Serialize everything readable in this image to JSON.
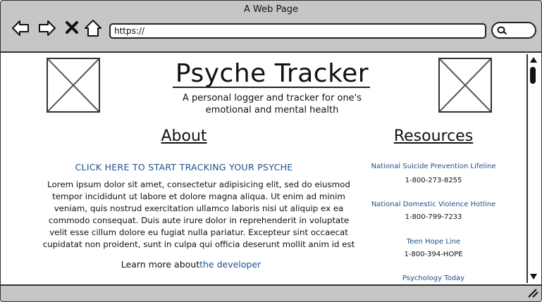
{
  "window": {
    "title": "A Web Page"
  },
  "toolbar": {
    "url": "https://"
  },
  "page": {
    "title": "Psyche Tracker",
    "tagline": "A personal logger and tracker for one's emotional and mental health",
    "about": {
      "heading": "About",
      "cta": "CLICK HERE TO START TRACKING YOUR PSYCHE",
      "body": "Lorem ipsum dolor sit amet, consectetur adipisicing elit, sed do eiusmod tempor incididunt ut labore et dolore magna aliqua. Ut enim ad minim veniam, quis nostrud exercitation ullamco laboris nisi ut aliquip ex ea commodo consequat. Duis aute irure dolor in reprehenderit in voluptate velit esse cillum dolore eu fugiat nulla pariatur. Excepteur sint occaecat cupidatat non proident, sunt in culpa qui officia deserunt mollit anim id est",
      "learn_more_prefix": "Learn more about",
      "learn_more_link": "the developer"
    },
    "resources": {
      "heading": "Resources",
      "items": [
        {
          "name": "National Suicide Prevention Lifeline",
          "phone": "1-800-273-8255"
        },
        {
          "name": "National Domestic Violence Hotline",
          "phone": "1-800-799-7233"
        },
        {
          "name": "Teen Hope Line",
          "phone": "1-800-394-HOPE"
        },
        {
          "name": "Psychology Today",
          "phone": ""
        }
      ]
    }
  },
  "icons": {
    "back": "arrow-left-icon",
    "forward": "arrow-right-icon",
    "stop": "close-icon",
    "home": "home-icon",
    "search": "search-icon"
  },
  "colors": {
    "link": "#1d4f8b",
    "chrome": "#c6c6c6"
  }
}
